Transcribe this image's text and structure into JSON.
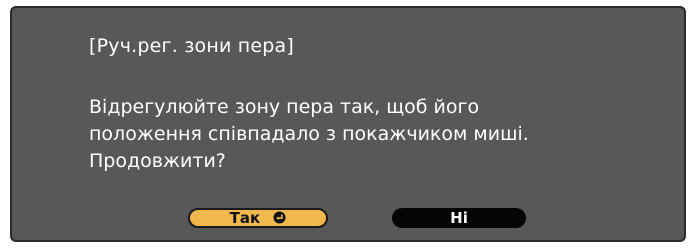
{
  "dialog": {
    "title": "[Руч.рег. зони пера]",
    "message_lines": [
      "Відрегулюйте зону пера так, щоб його",
      "положення співпадало з покажчиком миші.",
      "Продовжити?"
    ],
    "buttons": {
      "yes_label": "Так",
      "no_label": "Ні"
    },
    "icons": {
      "enter": "enter-icon"
    },
    "colors": {
      "background": "#585858",
      "yes_button": "#f1b84e",
      "no_button": "#050505",
      "text": "#ffffff"
    }
  }
}
